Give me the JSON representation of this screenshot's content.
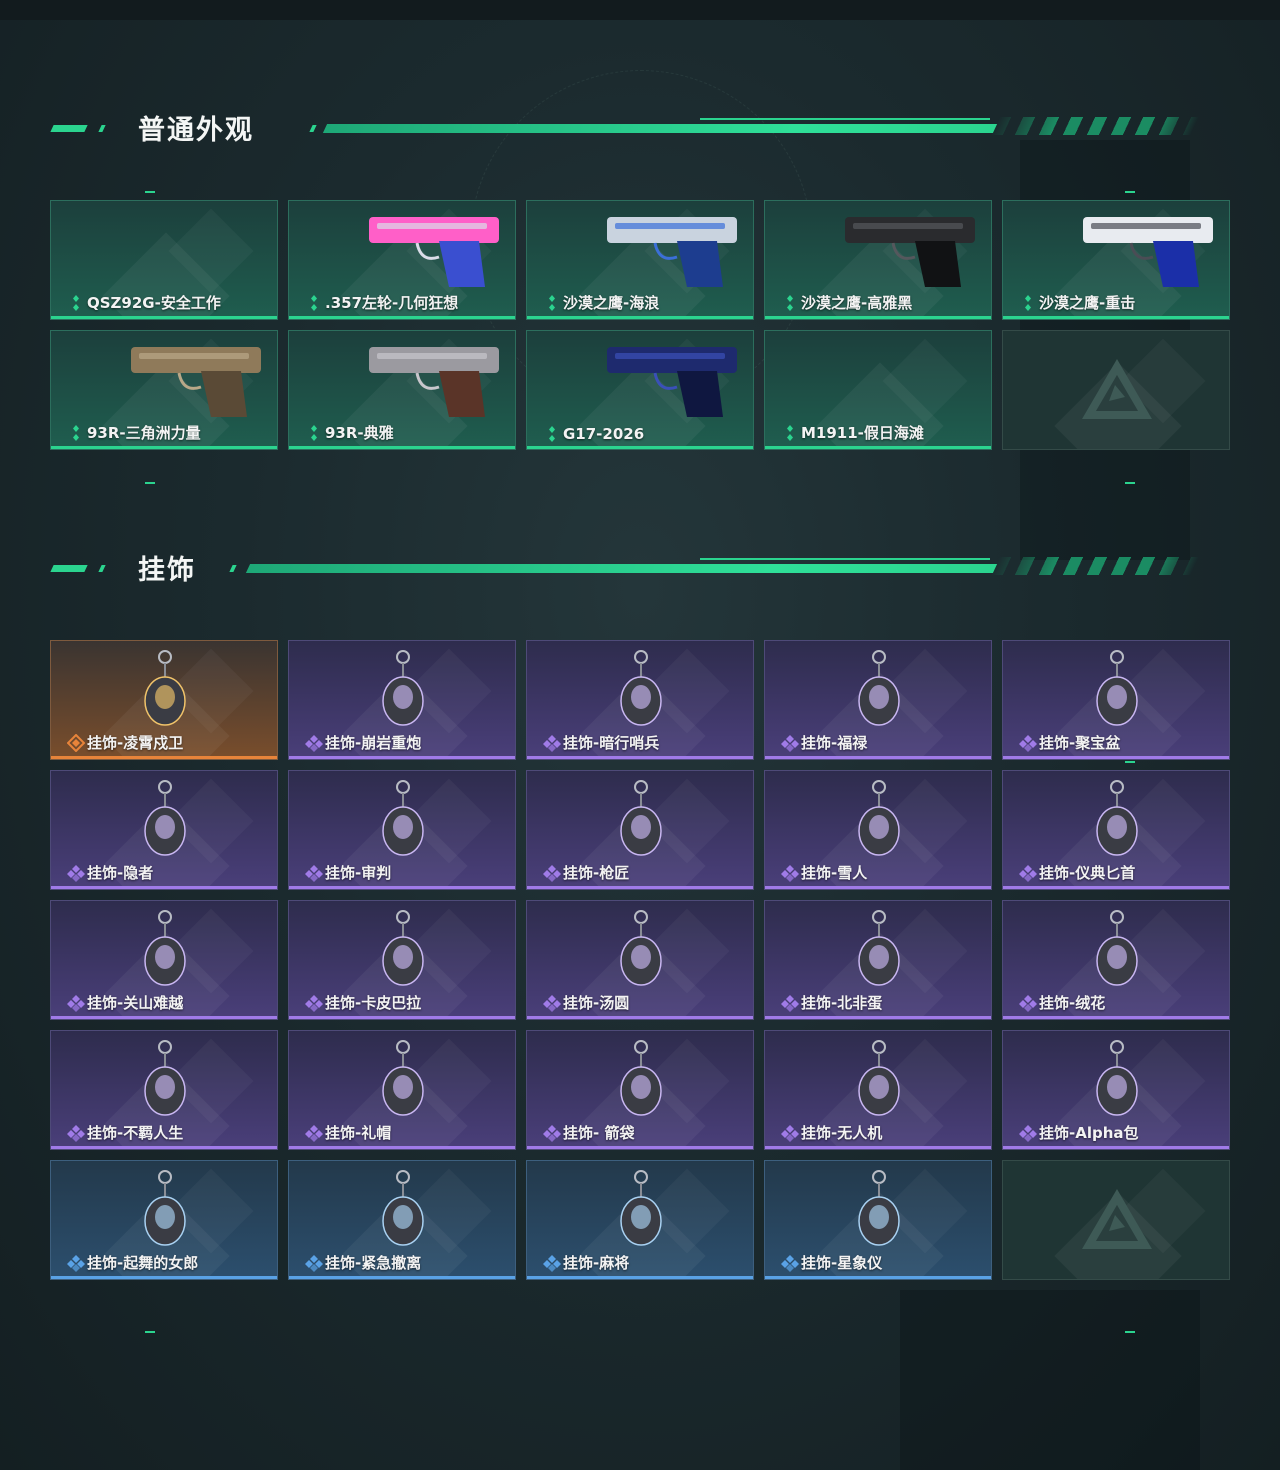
{
  "section_weapons": {
    "title": "普通外观",
    "items": [
      {
        "label": "QSZ92G-安全工作",
        "rarity": "green",
        "image": "none"
      },
      {
        "label": ".357左轮-几何狂想",
        "rarity": "green",
        "image": "revolver-pink"
      },
      {
        "label": "沙漠之鹰-海浪",
        "rarity": "green",
        "image": "deagle-blue"
      },
      {
        "label": "沙漠之鹰-高雅黑",
        "rarity": "green",
        "image": "deagle-black"
      },
      {
        "label": "沙漠之鹰-重击",
        "rarity": "green",
        "image": "deagle-white"
      },
      {
        "label": "93R-三角洲力量",
        "rarity": "green",
        "image": "pistol-tan"
      },
      {
        "label": "93R-典雅",
        "rarity": "green",
        "image": "pistol-wood"
      },
      {
        "label": "G17-2026",
        "rarity": "green",
        "image": "glock-blue"
      },
      {
        "label": "M1911-假日海滩",
        "rarity": "green",
        "image": "none"
      },
      {
        "label": "",
        "rarity": "empty",
        "image": "placeholder-logo"
      }
    ]
  },
  "section_charms": {
    "title": "挂饰",
    "items": [
      {
        "label": "挂饰-凌霄戍卫",
        "rarity": "orange",
        "image": "charm-guard"
      },
      {
        "label": "挂饰-崩岩重炮",
        "rarity": "purple",
        "image": "charm-figure"
      },
      {
        "label": "挂饰-暗行哨兵",
        "rarity": "purple",
        "image": "charm-soldier"
      },
      {
        "label": "挂饰-福禄",
        "rarity": "purple",
        "image": "charm-gourd"
      },
      {
        "label": "挂饰-聚宝盆",
        "rarity": "purple",
        "image": "charm-bowl"
      },
      {
        "label": "挂饰-隐者",
        "rarity": "purple",
        "image": "charm-card-red"
      },
      {
        "label": "挂饰-审判",
        "rarity": "purple",
        "image": "charm-card-blue"
      },
      {
        "label": "挂饰-枪匠",
        "rarity": "purple",
        "image": "charm-box"
      },
      {
        "label": "挂饰-雪人",
        "rarity": "purple",
        "image": "charm-snowman"
      },
      {
        "label": "挂饰-仪典匕首",
        "rarity": "purple",
        "image": "charm-dagger"
      },
      {
        "label": "挂饰-关山难越",
        "rarity": "purple",
        "image": "charm-yellow"
      },
      {
        "label": "挂饰-卡皮巴拉",
        "rarity": "purple",
        "image": "charm-capybara"
      },
      {
        "label": "挂饰-汤圆",
        "rarity": "purple",
        "image": "charm-bowl-red"
      },
      {
        "label": "挂饰-北非蛋",
        "rarity": "purple",
        "image": "charm-pan"
      },
      {
        "label": "挂饰-绒花",
        "rarity": "purple",
        "image": "charm-flower"
      },
      {
        "label": "挂饰-不羁人生",
        "rarity": "purple",
        "image": "charm-shoe"
      },
      {
        "label": "挂饰-礼帽",
        "rarity": "purple",
        "image": "charm-hat"
      },
      {
        "label": "挂饰- 箭袋",
        "rarity": "purple",
        "image": "charm-quiver"
      },
      {
        "label": "挂饰-无人机",
        "rarity": "purple",
        "image": "charm-drone"
      },
      {
        "label": "挂饰-Alpha包",
        "rarity": "purple",
        "image": "charm-bag"
      },
      {
        "label": "挂饰-起舞的女郎",
        "rarity": "blue",
        "image": "charm-dancer"
      },
      {
        "label": "挂饰-紧急撤离",
        "rarity": "blue",
        "image": "charm-green-box"
      },
      {
        "label": "挂饰-麻将",
        "rarity": "blue",
        "image": "charm-mahjong"
      },
      {
        "label": "挂饰-星象仪",
        "rarity": "blue",
        "image": "charm-astrolabe"
      },
      {
        "label": "",
        "rarity": "empty",
        "image": "placeholder-logo"
      }
    ]
  },
  "colors": {
    "accent": "#2bd48f",
    "green": "#2bd48f",
    "purple": "#a07be8",
    "orange": "#e8843a",
    "blue": "#5aa2e6"
  }
}
